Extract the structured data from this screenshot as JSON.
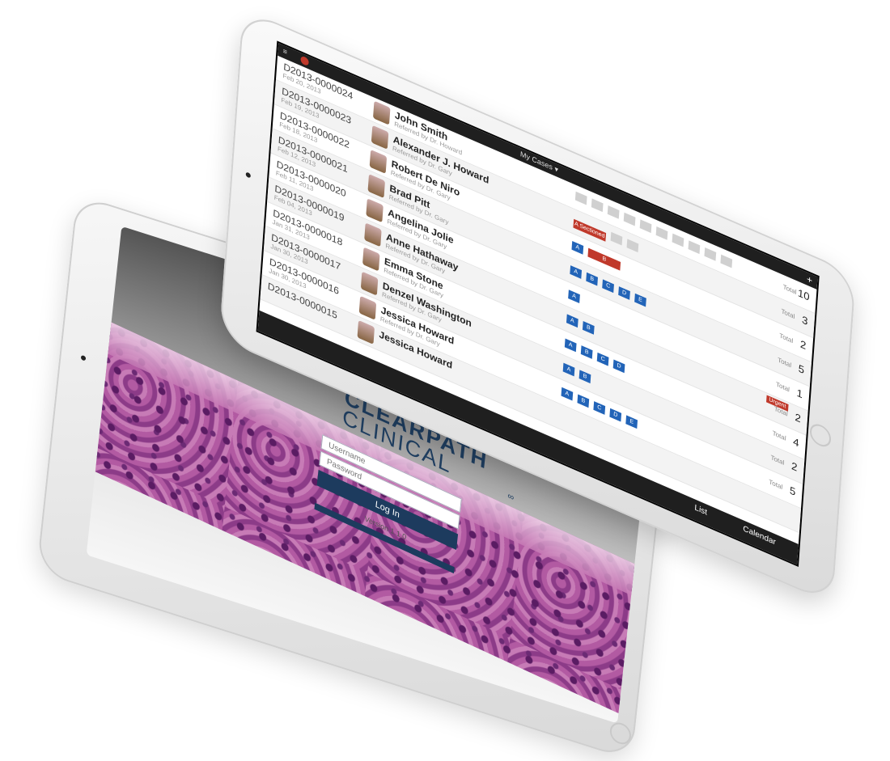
{
  "login": {
    "brand_line1": "CLEARPATH",
    "brand_line2": "CLINICAL",
    "brand_mark": "∞",
    "username_placeholder": "Username",
    "password_placeholder": "Password",
    "login_button": "Log In",
    "version": "Version 1.1.0"
  },
  "cases_app": {
    "header_title": "My Cases ▾",
    "menu_icon": "≡",
    "add_icon": "+",
    "tabs": {
      "list": "List",
      "calendar": "Calendar"
    },
    "rows": [
      {
        "case_id": "D2013-0000024",
        "date": "Feb 20, 2013",
        "patient": "John Smith",
        "patient_sub": "Referred by Dr. Howard",
        "total_label": "Total",
        "total": "10",
        "chips": [
          "gray",
          "gray",
          "gray",
          "gray",
          "gray",
          "gray",
          "gray",
          "gray",
          "gray",
          "gray"
        ],
        "chip_labels": [
          "",
          "",
          "",
          "",
          "",
          "",
          "",
          "",
          "",
          ""
        ],
        "tag": ""
      },
      {
        "case_id": "D2013-0000023",
        "date": "Feb 19, 2013",
        "patient": "Alexander J. Howard",
        "patient_sub": "Referred by Dr. Gary",
        "total_label": "Total",
        "total": "3",
        "chips": [
          "red",
          "gray",
          "gray"
        ],
        "chip_labels": [
          "A  Sectioned",
          "",
          ""
        ],
        "tag": ""
      },
      {
        "case_id": "D2013-0000022",
        "date": "Feb 18, 2013",
        "patient": "Robert De Niro",
        "patient_sub": "Referred by Dr. Gary",
        "total_label": "Total",
        "total": "2",
        "chips": [
          "blue",
          "red"
        ],
        "chip_labels": [
          "A",
          "B"
        ],
        "tag": ""
      },
      {
        "case_id": "D2013-0000021",
        "date": "Feb 12, 2013",
        "patient": "Brad Pitt",
        "patient_sub": "Referred by Dr. Gary",
        "total_label": "Total",
        "total": "5",
        "chips": [
          "blue",
          "blue",
          "blue",
          "blue",
          "blue"
        ],
        "chip_labels": [
          "A",
          "B",
          "C",
          "D",
          "E"
        ],
        "tag": ""
      },
      {
        "case_id": "D2013-0000020",
        "date": "Feb 11, 2013",
        "patient": "Angelina Jolie",
        "patient_sub": "Referred by Dr. Gary",
        "total_label": "Total",
        "total": "1",
        "chips": [
          "blue"
        ],
        "chip_labels": [
          "A"
        ],
        "tag": ""
      },
      {
        "case_id": "D2013-0000019",
        "date": "Feb 04, 2013",
        "patient": "Anne Hathaway",
        "patient_sub": "Referred by Dr. Gary",
        "total_label": "Total",
        "total": "2",
        "chips": [
          "blue",
          "blue"
        ],
        "chip_labels": [
          "A",
          "B"
        ],
        "tag": "Urgent"
      },
      {
        "case_id": "D2013-0000018",
        "date": "Jan 31, 2013",
        "patient": "Emma Stone",
        "patient_sub": "Referred by Dr. Gary",
        "total_label": "Total",
        "total": "4",
        "chips": [
          "blue",
          "blue",
          "blue",
          "blue"
        ],
        "chip_labels": [
          "A",
          "B",
          "C",
          "D"
        ],
        "tag": ""
      },
      {
        "case_id": "D2013-0000017",
        "date": "Jan 30, 2013",
        "patient": "Denzel Washington",
        "patient_sub": "Referred by Dr. Gary",
        "total_label": "Total",
        "total": "2",
        "chips": [
          "blue",
          "blue"
        ],
        "chip_labels": [
          "A",
          "B"
        ],
        "tag": ""
      },
      {
        "case_id": "D2013-0000016",
        "date": "Jan 30, 2013",
        "patient": "Jessica Howard",
        "patient_sub": "Referred by Dr. Gary",
        "total_label": "Total",
        "total": "5",
        "chips": [
          "blue",
          "blue",
          "blue",
          "blue",
          "blue"
        ],
        "chip_labels": [
          "A",
          "B",
          "C",
          "D",
          "E"
        ],
        "tag": ""
      },
      {
        "case_id": "D2013-0000015",
        "date": "",
        "patient": "Jessica Howard",
        "patient_sub": "",
        "total_label": "",
        "total": "",
        "chips": [],
        "chip_labels": [],
        "tag": ""
      }
    ]
  }
}
